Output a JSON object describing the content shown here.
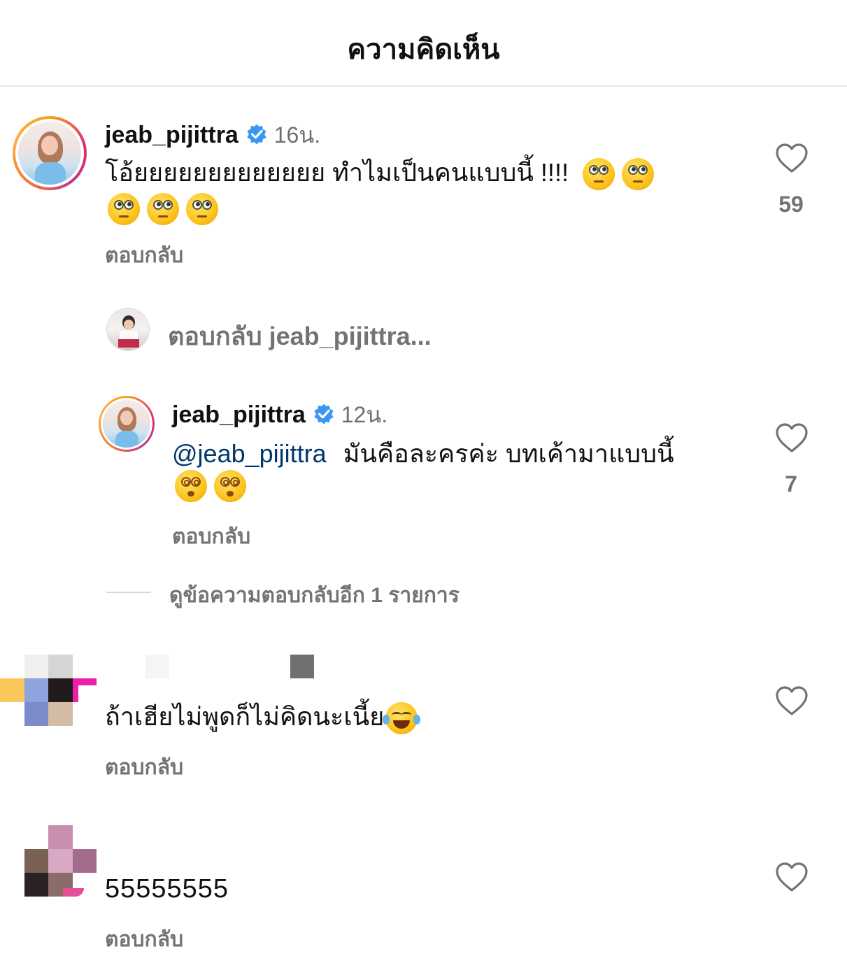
{
  "header": {
    "title": "ความคิดเห็น"
  },
  "colors": {
    "mention": "#00376b",
    "verified": "#3897f0",
    "muted": "#737373"
  },
  "comments": [
    {
      "username": "jeab_pijittra",
      "verified": true,
      "time": "16น.",
      "text": "โอ้ยยยยยยยยยยยยย ทำไมเป็นคนแบบนี้ !!!!",
      "emoji": [
        "face-with-rolling-eyes",
        "face-with-rolling-eyes",
        "face-with-rolling-eyes",
        "face-with-rolling-eyes",
        "face-with-rolling-eyes"
      ],
      "reply_label": "ตอบกลับ",
      "likes": "59"
    }
  ],
  "reply_composer": {
    "prefix": "ตอบกลับ",
    "target": "jeab_pijittra..."
  },
  "replies": [
    {
      "username": "jeab_pijittra",
      "verified": true,
      "time": "12น.",
      "mention": "@jeab_pijittra",
      "text": "มันคือละครค่ะ บทเค้ามาแบบนี้",
      "emoji": [
        "face-with-spiral-eyes",
        "face-with-spiral-eyes"
      ],
      "reply_label": "ตอบกลับ",
      "likes": "7"
    }
  ],
  "view_more_replies": "ดูข้อความตอบกลับอีก 1 รายการ",
  "comments_more": [
    {
      "text": "ถ้าเฮียไม่พูดก็ไม่คิดนะเนี้ย",
      "emoji": [
        "face-with-tears-of-joy"
      ],
      "reply_label": "ตอบกลับ"
    },
    {
      "text": "55555555",
      "reply_label": "ตอบกลับ"
    }
  ]
}
